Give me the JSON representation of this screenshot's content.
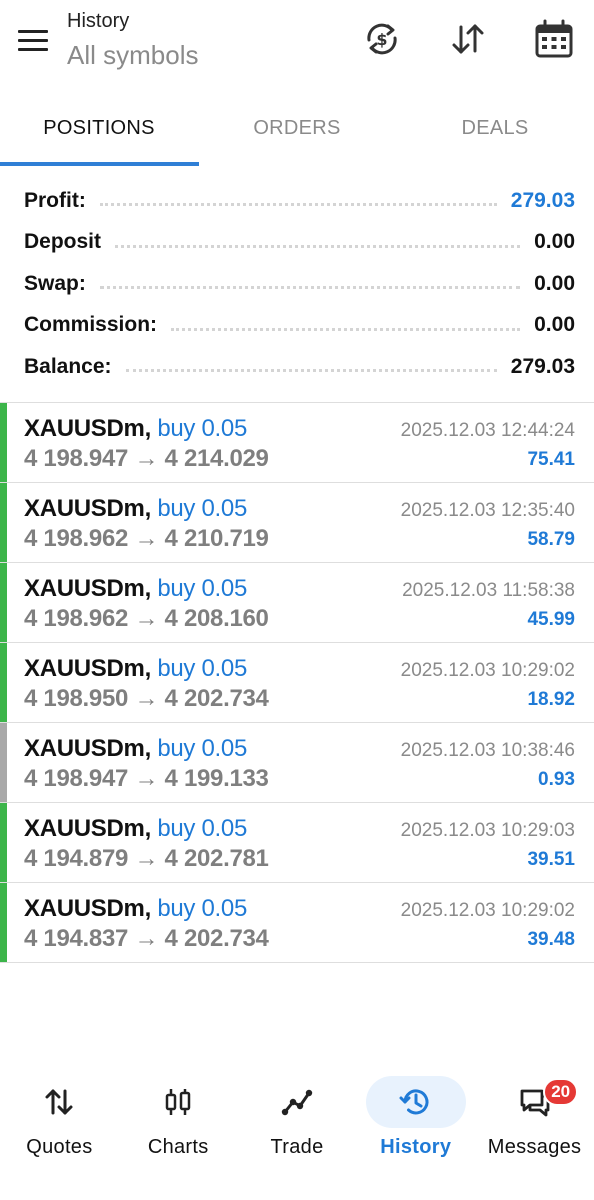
{
  "header": {
    "title": "History",
    "subtitle": "All symbols",
    "icons": [
      "menu-icon",
      "currency-sync-icon",
      "sort-icon",
      "calendar-icon"
    ]
  },
  "tabs": [
    {
      "label": "POSITIONS",
      "active": true
    },
    {
      "label": "ORDERS",
      "active": false
    },
    {
      "label": "DEALS",
      "active": false
    }
  ],
  "summary": [
    {
      "label": "Profit:",
      "value": "279.03",
      "highlight": true
    },
    {
      "label": "Deposit",
      "value": "0.00",
      "highlight": false
    },
    {
      "label": "Swap:",
      "value": "0.00",
      "highlight": false
    },
    {
      "label": "Commission:",
      "value": "0.00",
      "highlight": false
    },
    {
      "label": "Balance:",
      "value": "279.03",
      "highlight": false
    }
  ],
  "deals": [
    {
      "symbol": "XAUUSDm,",
      "side": "buy 0.05",
      "open": "4 198.947",
      "close": "4 214.029",
      "time": "2025.12.03 12:44:24",
      "profit": "75.41",
      "bar_color": "#3cb54a"
    },
    {
      "symbol": "XAUUSDm,",
      "side": "buy 0.05",
      "open": "4 198.962",
      "close": "4 210.719",
      "time": "2025.12.03 12:35:40",
      "profit": "58.79",
      "bar_color": "#3cb54a"
    },
    {
      "symbol": "XAUUSDm,",
      "side": "buy 0.05",
      "open": "4 198.962",
      "close": "4 208.160",
      "time": "2025.12.03 11:58:38",
      "profit": "45.99",
      "bar_color": "#3cb54a"
    },
    {
      "symbol": "XAUUSDm,",
      "side": "buy 0.05",
      "open": "4 198.950",
      "close": "4 202.734",
      "time": "2025.12.03 10:29:02",
      "profit": "18.92",
      "bar_color": "#3cb54a"
    },
    {
      "symbol": "XAUUSDm,",
      "side": "buy 0.05",
      "open": "4 198.947",
      "close": "4 199.133",
      "time": "2025.12.03 10:38:46",
      "profit": "0.93",
      "bar_color": "#a9a9a9"
    },
    {
      "symbol": "XAUUSDm,",
      "side": "buy 0.05",
      "open": "4 194.879",
      "close": "4 202.781",
      "time": "2025.12.03 10:29:03",
      "profit": "39.51",
      "bar_color": "#3cb54a"
    },
    {
      "symbol": "XAUUSDm,",
      "side": "buy 0.05",
      "open": "4 194.837",
      "close": "4 202.734",
      "time": "2025.12.03 10:29:02",
      "profit": "39.48",
      "bar_color": "#3cb54a"
    }
  ],
  "arrow": "→",
  "bottom_nav": [
    {
      "label": "Quotes",
      "icon": "quotes-icon",
      "active": false
    },
    {
      "label": "Charts",
      "icon": "charts-icon",
      "active": false
    },
    {
      "label": "Trade",
      "icon": "trade-icon",
      "active": false
    },
    {
      "label": "History",
      "icon": "history-icon",
      "active": true
    },
    {
      "label": "Messages",
      "icon": "messages-icon",
      "active": false,
      "badge": "20"
    }
  ],
  "colors": {
    "accent": "#1f7ad6",
    "profit_bar": "#3cb54a",
    "neutral_bar": "#a9a9a9",
    "badge": "#e53935"
  }
}
